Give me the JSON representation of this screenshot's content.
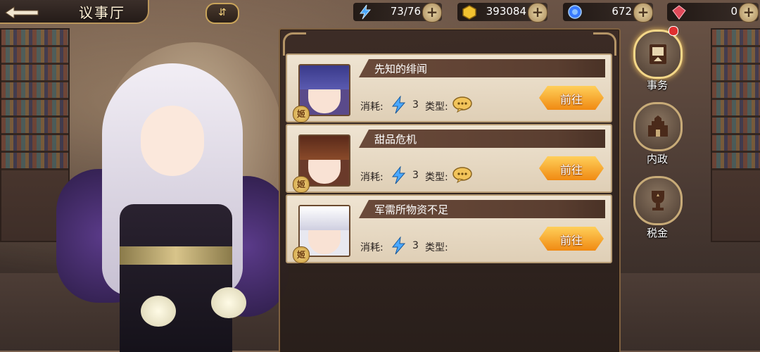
{
  "header": {
    "title": "议事厅",
    "scroll_icon": "scroll-icon"
  },
  "resources": [
    {
      "name": "stamina",
      "icon": "lightning-icon",
      "value": "73/76",
      "color": "#4aa8ff"
    },
    {
      "name": "gold",
      "icon": "gold-icon",
      "value": "393084",
      "color": "#f2c230"
    },
    {
      "name": "gem-blue",
      "icon": "blue-gem-icon",
      "value": "672",
      "color": "#3a7bff"
    },
    {
      "name": "gem-red",
      "icon": "red-gem-icon",
      "value": "0",
      "color": "#e04a5a"
    }
  ],
  "tasks": [
    {
      "title": "先知的绯闻",
      "cost_label": "消耗:",
      "cost": "3",
      "type_label": "类型:",
      "type_icon": "chat-bubble-icon",
      "go_label": "前往",
      "portrait": "purple-hair-girl"
    },
    {
      "title": "甜品危机",
      "cost_label": "消耗:",
      "cost": "3",
      "type_label": "类型:",
      "type_icon": "chat-bubble-icon",
      "go_label": "前往",
      "portrait": "brown-hair-girl"
    },
    {
      "title": "军需所物资不足",
      "cost_label": "消耗:",
      "cost": "3",
      "type_label": "类型:",
      "type_icon": "",
      "go_label": "前往",
      "portrait": "white-hair-girl"
    }
  ],
  "badge_label": "姬",
  "side_menu": [
    {
      "label": "事务",
      "icon": "affairs-icon",
      "active": true
    },
    {
      "label": "内政",
      "icon": "castle-icon",
      "active": false
    },
    {
      "label": "税金",
      "icon": "trophy-icon",
      "active": false
    }
  ]
}
